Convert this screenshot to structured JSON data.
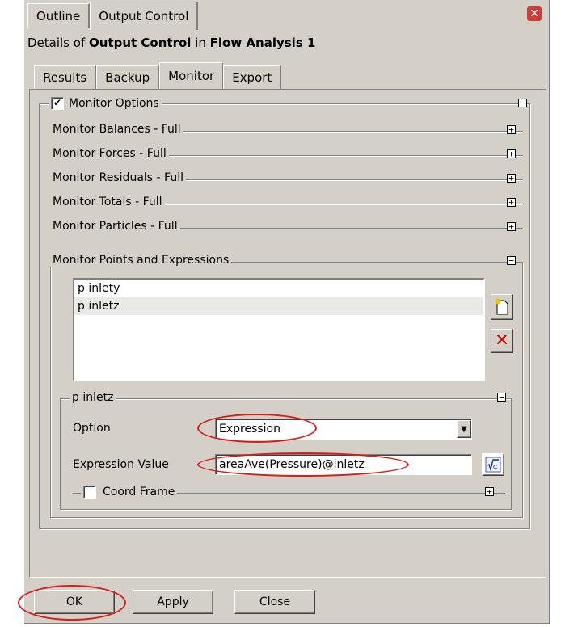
{
  "window": {
    "tabs": [
      "Outline",
      "Output Control"
    ],
    "details_prefix": "Details of ",
    "details_object": "Output Control",
    "details_in": " in ",
    "details_analysis": "Flow Analysis 1"
  },
  "subtabs": [
    "Results",
    "Backup",
    "Monitor",
    "Export"
  ],
  "monitor_options": {
    "label": "Monitor Options",
    "checked": true,
    "sections": [
      "Monitor Balances - Full",
      "Monitor Forces - Full",
      "Monitor Residuals - Full",
      "Monitor Totals - Full",
      "Monitor Particles - Full"
    ],
    "points_title": "Monitor Points and Expressions",
    "points": [
      "p inlety",
      "p inletz"
    ],
    "selected_point": "p inletz"
  },
  "detail": {
    "title": "p inletz",
    "option_label": "Option",
    "option_value": "Expression",
    "expression_label": "Expression Value",
    "expression_value": "areaAve(Pressure)@inletz",
    "coord_frame_label": "Coord Frame"
  },
  "buttons": {
    "ok": "OK",
    "apply": "Apply",
    "close": "Close"
  },
  "colors": {
    "panel": "#d4d0c8",
    "highlight_ellipse": "#d62020"
  }
}
